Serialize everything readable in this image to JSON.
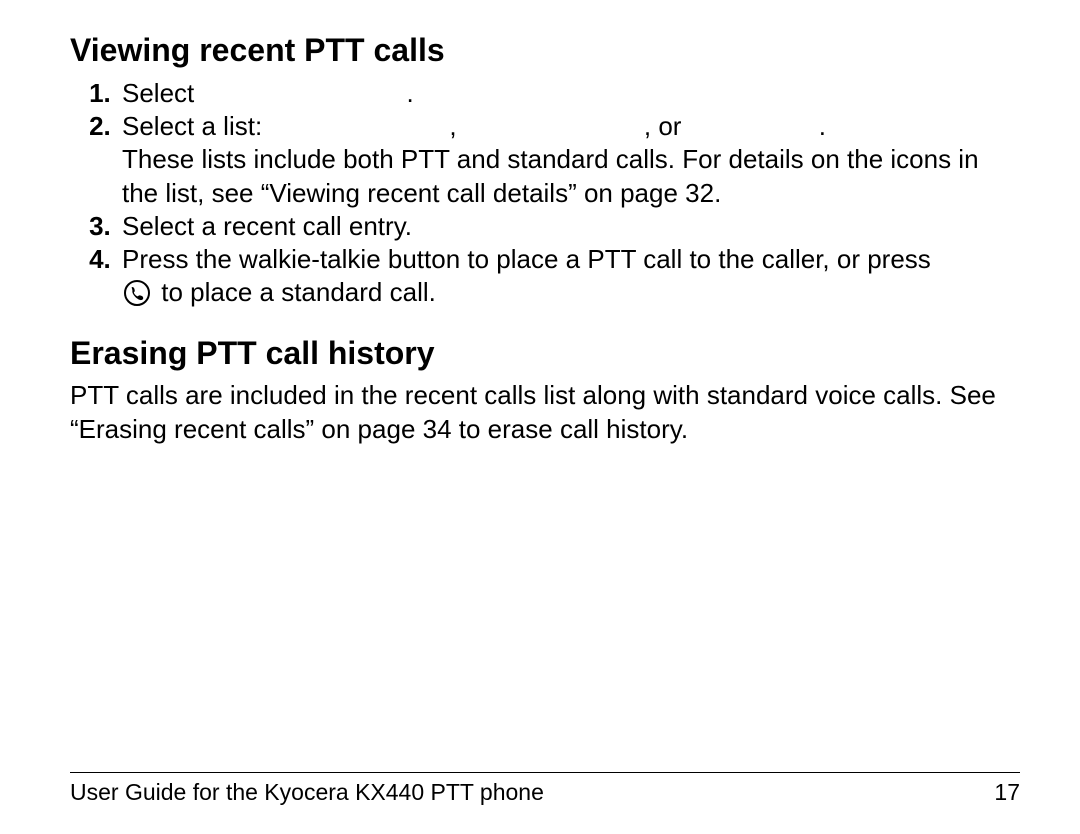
{
  "section1": {
    "heading": "Viewing recent PTT calls",
    "steps": {
      "s1_a": "Select",
      "s1_b": ".",
      "s2_a": "Select a list:",
      "s2_b": ",",
      "s2_c": ", or",
      "s2_d": ".",
      "s2_body": "These lists include both PTT and standard calls. For details on the icons in the list, see “Viewing recent call details” on page 32.",
      "s3": "Select a recent call entry.",
      "s4_a": "Press the walkie-talkie button to place a PTT call to the caller, or press ",
      "s4_b": " to place a standard call."
    }
  },
  "section2": {
    "heading": "Erasing PTT call history",
    "body": "PTT calls are included in the recent calls list along with standard voice calls. See “Erasing recent calls” on page 34 to erase call history."
  },
  "footer": {
    "left": "User Guide for the Kyocera KX440 PTT phone",
    "right": "17"
  }
}
